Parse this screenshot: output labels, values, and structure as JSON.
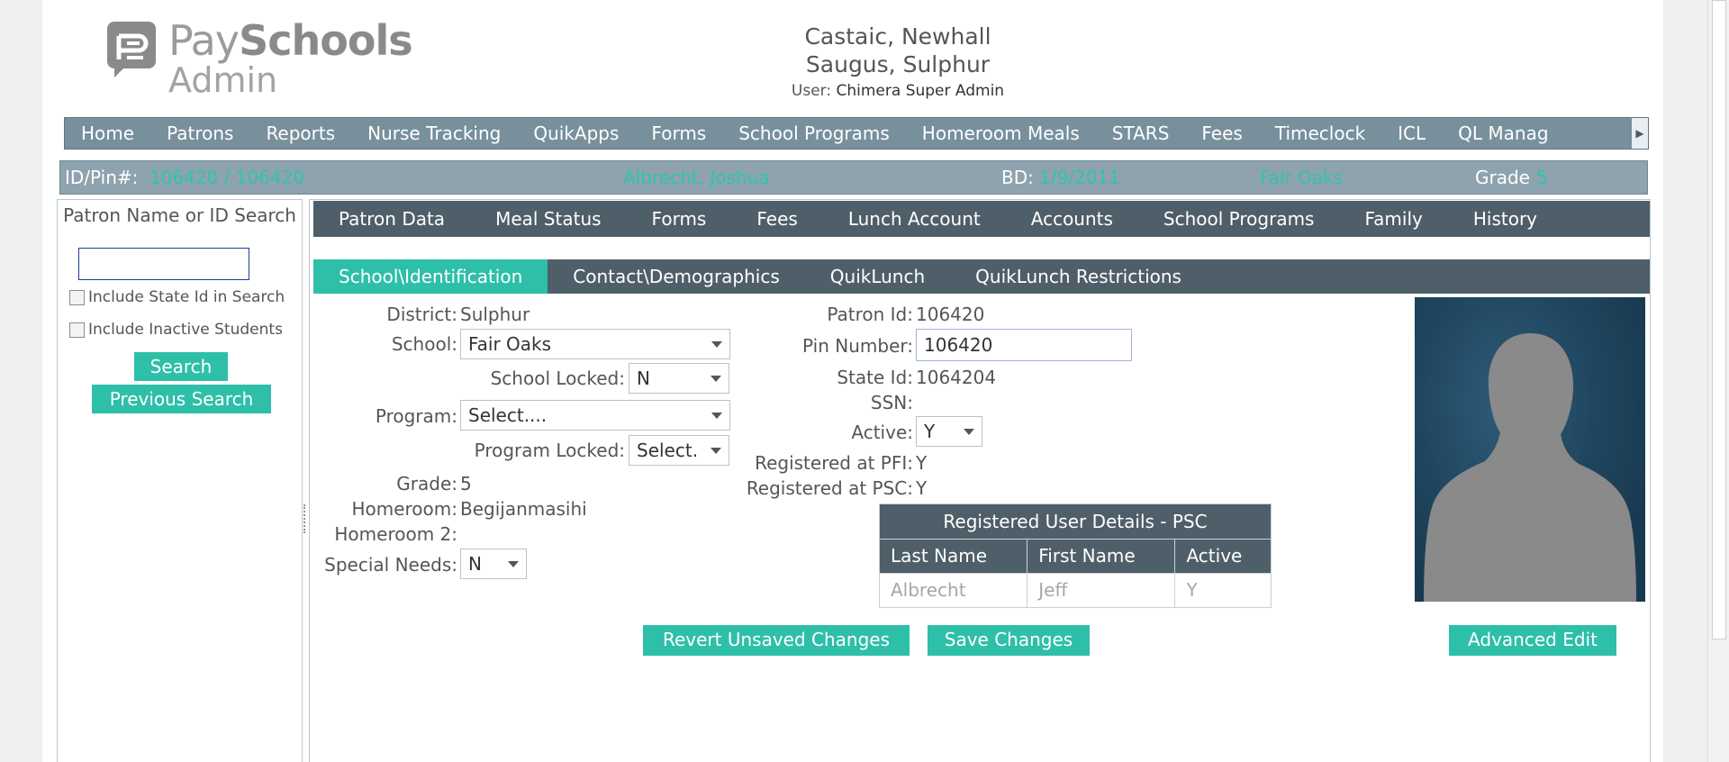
{
  "app": {
    "logo_pay": "Pay",
    "logo_schools": "Schools",
    "logo_admin": "Admin"
  },
  "header": {
    "districts_line1": "Castaic, Newhall",
    "districts_line2": "Saugus, Sulphur",
    "user_label": "User:",
    "user_name": "Chimera Super Admin"
  },
  "main_nav": [
    "Home",
    "Patrons",
    "Reports",
    "Nurse Tracking",
    "QuikApps",
    "Forms",
    "School Programs",
    "Homeroom Meals",
    "STARS",
    "Fees",
    "Timeclock",
    "ICL",
    "QL Manag"
  ],
  "patron_bar": {
    "id_label": "ID/Pin#:",
    "id_value": "106420 / 106420",
    "name": "Albrecht, Joshua",
    "bd_label": "BD:",
    "bd_value": "1/9/2011",
    "school": "Fair Oaks",
    "grade_label": "Grade",
    "grade_value": "5"
  },
  "left_panel": {
    "title": "Patron Name or ID Search",
    "search_value": "",
    "include_state_id": "Include State Id in Search",
    "include_inactive": "Include Inactive Students",
    "search_button": "Search",
    "previous_search_button": "Previous Search"
  },
  "tabs_primary": [
    "Patron Data",
    "Meal Status",
    "Forms",
    "Fees",
    "Lunch Account",
    "Accounts",
    "School Programs",
    "Family",
    "History"
  ],
  "tabs_secondary": [
    "School\\Identification",
    "Contact\\Demographics",
    "QuikLunch",
    "QuikLunch Restrictions"
  ],
  "form": {
    "district_label": "District:",
    "district_value": "Sulphur",
    "school_label": "School:",
    "school_value": "Fair Oaks",
    "school_locked_label": "School Locked:",
    "school_locked_value": "N",
    "program_label": "Program:",
    "program_value": "Select....",
    "program_locked_label": "Program Locked:",
    "program_locked_value": "Select.",
    "grade_label": "Grade:",
    "grade_value": "5",
    "homeroom_label": "Homeroom:",
    "homeroom_value": "Begijanmasihi",
    "homeroom2_label": "Homeroom 2:",
    "homeroom2_value": "",
    "special_needs_label": "Special Needs:",
    "special_needs_value": "N",
    "patron_id_label": "Patron Id:",
    "patron_id_value": "106420",
    "pin_label": "Pin Number:",
    "pin_value": "106420",
    "state_id_label": "State Id:",
    "state_id_value": "1064204",
    "ssn_label": "SSN:",
    "ssn_value": "",
    "active_label": "Active:",
    "active_value": "Y",
    "reg_pfi_label": "Registered at PFI:",
    "reg_pfi_value": "Y",
    "reg_psc_label": "Registered at PSC:",
    "reg_psc_value": "Y"
  },
  "registered_table": {
    "caption": "Registered User Details - PSC",
    "headers": [
      "Last Name",
      "First Name",
      "Active"
    ],
    "rows": [
      [
        "Albrecht",
        "Jeff",
        "Y"
      ]
    ]
  },
  "actions": {
    "revert": "Revert Unsaved Changes",
    "save": "Save Changes",
    "advanced": "Advanced Edit"
  },
  "colors": {
    "accent": "#2ebfa9",
    "nav": "#78909c",
    "tabs": "#4f5f69"
  }
}
